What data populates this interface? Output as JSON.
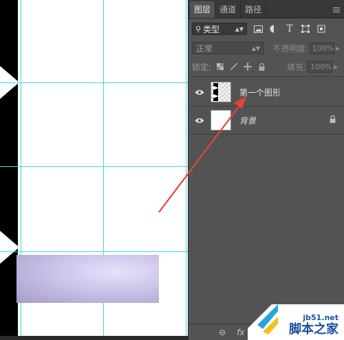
{
  "panel": {
    "tabs": [
      {
        "label": "图层"
      },
      {
        "label": "通道"
      },
      {
        "label": "路径"
      }
    ],
    "filter": {
      "kind_label": "类型"
    },
    "blend": {
      "mode": "正常",
      "opacity_label": "不透明度:",
      "opacity_value": "100%"
    },
    "lock": {
      "label": "锁定:",
      "fill_label": "填充:",
      "fill_value": "100%"
    },
    "layers": [
      {
        "name": "第一个图形",
        "visible": true
      },
      {
        "name": "背景",
        "visible": true,
        "locked": true
      }
    ],
    "footer": {
      "link": "⊖",
      "fx": "fx"
    }
  },
  "watermark": {
    "line1": "jb51.net",
    "line2": "脚本之家"
  },
  "colors": {
    "guide": "#3fd6e6",
    "arrow": "#e8423a",
    "panel_bg": "#535353",
    "watermark": "#1a4fa0"
  }
}
